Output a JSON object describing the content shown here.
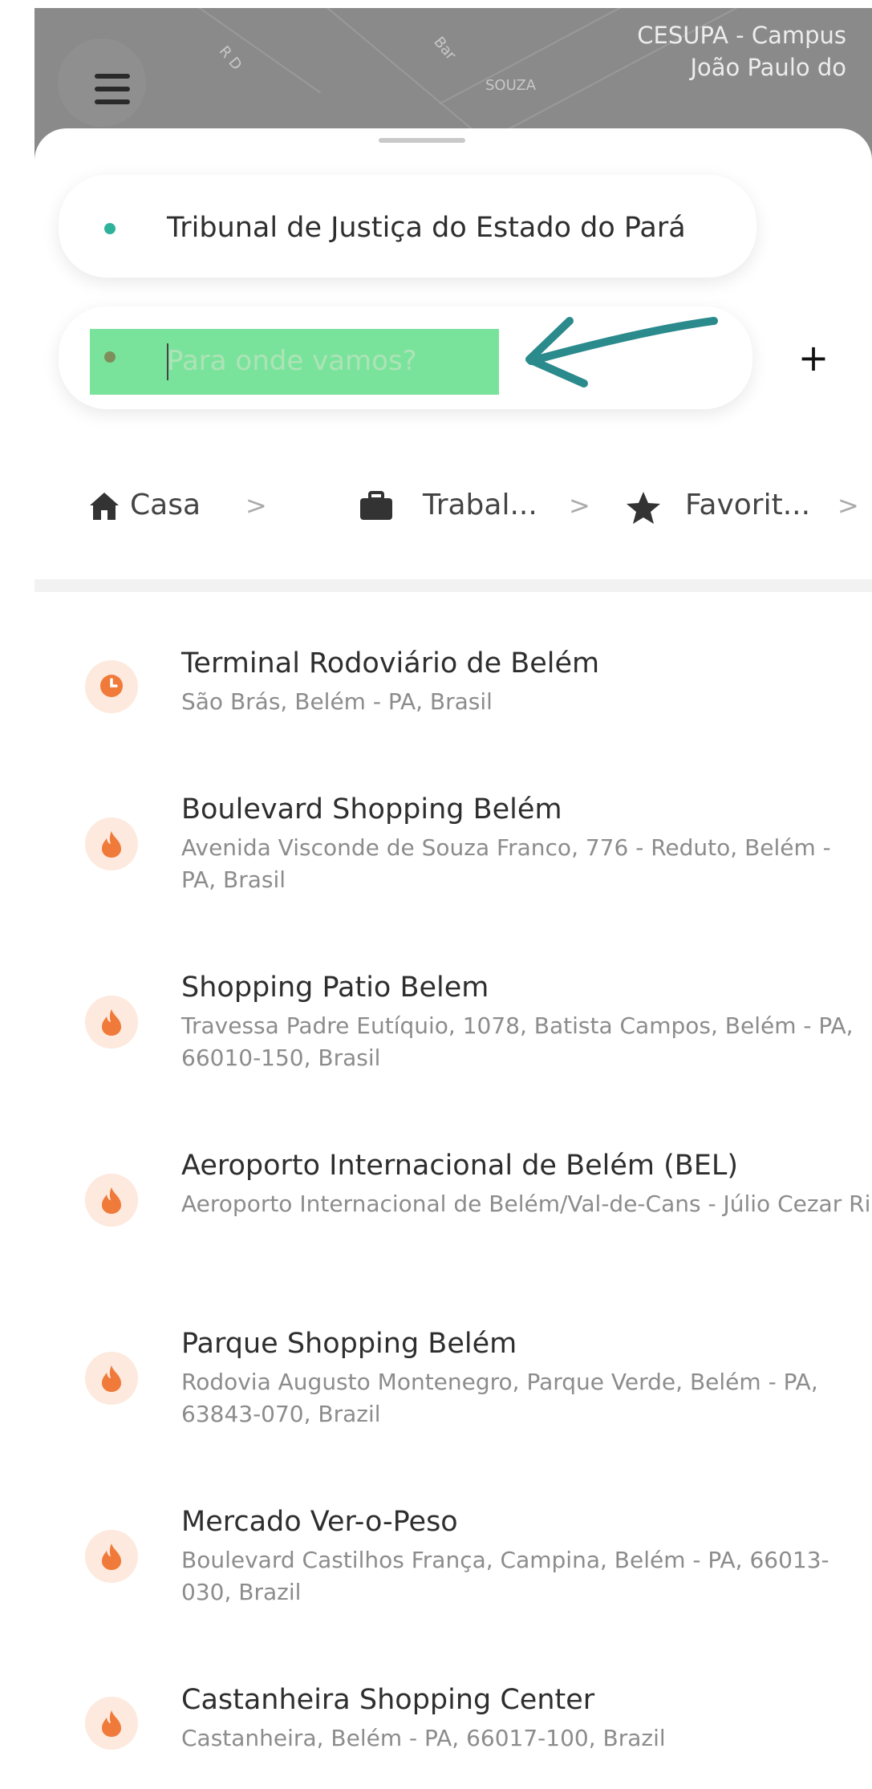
{
  "map": {
    "street_labels": [
      "R D",
      "SOUZA",
      "Bar"
    ],
    "poi_label": "CESUPA - Campus João Paulo do"
  },
  "search": {
    "origin": "Tribunal de Justiça do Estado do Pará",
    "destination_placeholder": "Para onde vamos?",
    "destination_value": "",
    "add_stop_label": "+"
  },
  "shortcuts": [
    {
      "icon": "home-icon",
      "label": "Casa",
      "chevron": ">"
    },
    {
      "icon": "briefcase-icon",
      "label": "Trabal...",
      "chevron": ">"
    },
    {
      "icon": "star-icon",
      "label": "Favorit...",
      "chevron": ">"
    }
  ],
  "places": [
    {
      "icon": "clock-icon",
      "name": "Terminal Rodoviário de Belém",
      "address": "São Brás, Belém - PA, Brasil"
    },
    {
      "icon": "flame-icon",
      "name": "Boulevard Shopping Belém",
      "address": "Avenida Visconde de Souza Franco, 776 - Reduto, Belém - PA, Brasil"
    },
    {
      "icon": "flame-icon",
      "name": "Shopping Patio Belem",
      "address": "Travessa Padre Eutíquio, 1078, Batista Campos, Belém - PA, 66010-150, Brasil"
    },
    {
      "icon": "flame-icon",
      "name": "Aeroporto Internacional de Belém (BEL)",
      "address": "Aeroporto Internacional de Belém/Val-de-Cans - Júlio Cezar Ribeiro (BEL) - Av. Júlio César, s/n - Val-de-Can..."
    },
    {
      "icon": "flame-icon",
      "name": "Parque Shopping Belém",
      "address": "Rodovia Augusto Montenegro, Parque Verde, Belém - PA, 63843-070, Brazil"
    },
    {
      "icon": "flame-icon",
      "name": "Mercado Ver-o-Peso",
      "address": "Boulevard Castilhos França, Campina, Belém - PA, 66013-030, Brazil"
    },
    {
      "icon": "flame-icon",
      "name": "Castanheira Shopping Center",
      "address": "Castanheira, Belém - PA, 66017-100, Brazil"
    }
  ],
  "colors": {
    "accent": "#f07a3a",
    "origin_dot": "#2fb29b",
    "highlight": "#79e39c",
    "annotation_arrow": "#2a8a8c"
  }
}
